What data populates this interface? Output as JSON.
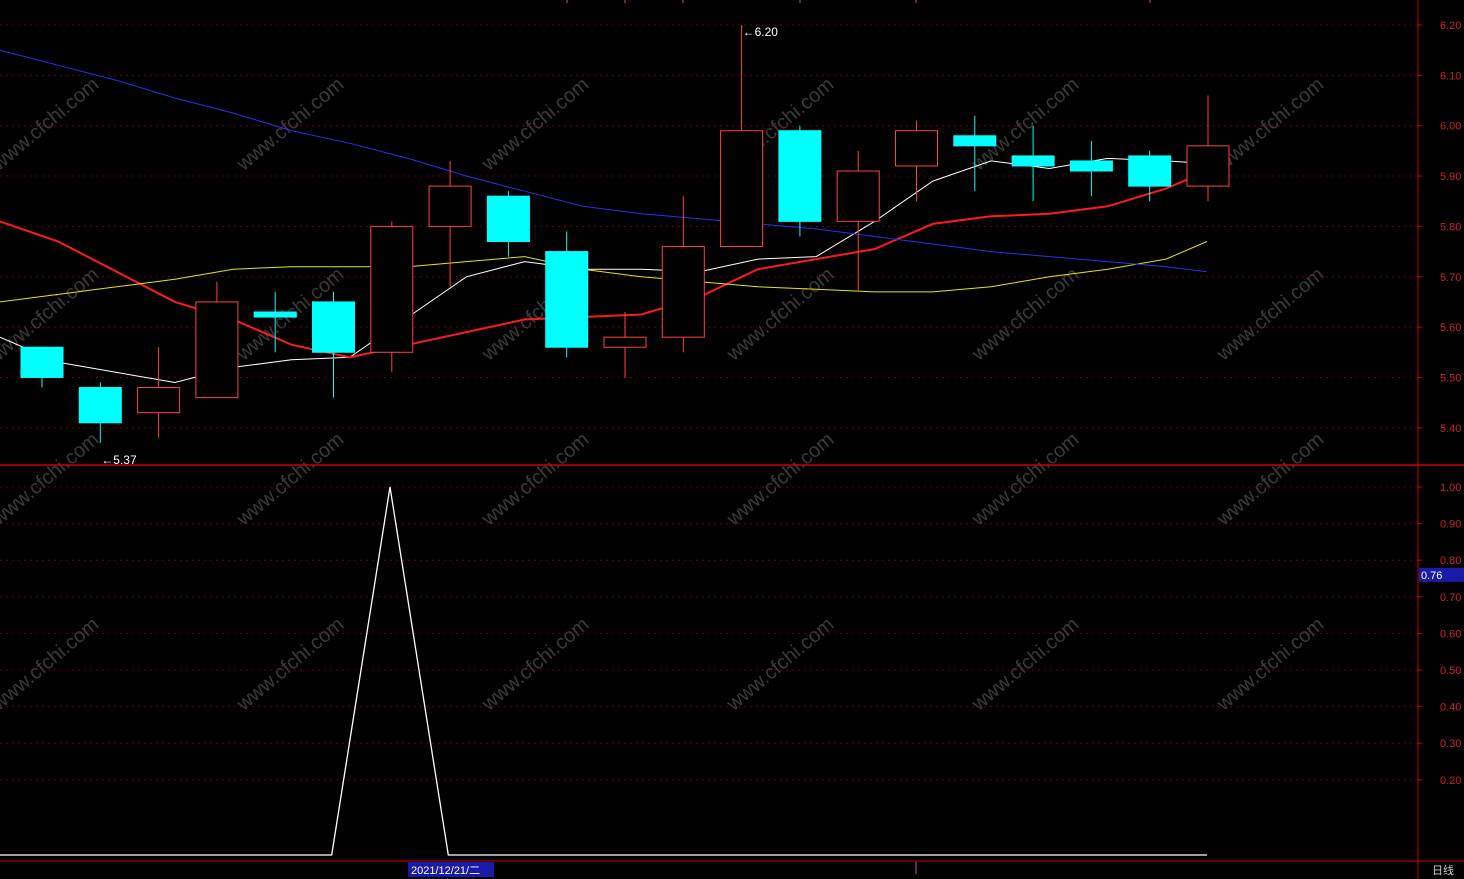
{
  "watermark": "www.cfchi.com",
  "period_label": "日线",
  "date_label": "2021/12/21/二",
  "colors": {
    "up": "#ff4040",
    "down": "#00ffff",
    "ma_white": "#ffffff",
    "ma_red": "#ff1a1a",
    "ma_yellow": "#e6e600",
    "ma_blue": "#2233ee",
    "axis": "#cc0000",
    "grid": "#6e0000",
    "highlight": "#1a1aa8"
  },
  "chart_data": [
    {
      "type": "candlestick",
      "name": "price",
      "y_ticks": [
        "6.20",
        "6.10",
        "6.00",
        "5.90",
        "5.80",
        "5.70",
        "5.60",
        "5.50",
        "5.40"
      ],
      "ylim": [
        5.325,
        6.235
      ],
      "grid": true,
      "annotations": [
        {
          "text": "6.20",
          "bar": 12,
          "value": 6.2
        },
        {
          "text": "5.37",
          "bar": 1,
          "value": 5.37
        }
      ],
      "candles": [
        {
          "open": 5.56,
          "high": 5.56,
          "low": 5.48,
          "close": 5.5
        },
        {
          "open": 5.48,
          "high": 5.49,
          "low": 5.37,
          "close": 5.41
        },
        {
          "open": 5.43,
          "high": 5.56,
          "low": 5.38,
          "close": 5.48
        },
        {
          "open": 5.46,
          "high": 5.69,
          "low": 5.46,
          "close": 5.65
        },
        {
          "open": 5.63,
          "high": 5.67,
          "low": 5.55,
          "close": 5.62
        },
        {
          "open": 5.65,
          "high": 5.67,
          "low": 5.46,
          "close": 5.55
        },
        {
          "open": 5.55,
          "high": 5.81,
          "low": 5.51,
          "close": 5.8
        },
        {
          "open": 5.8,
          "high": 5.93,
          "low": 5.68,
          "close": 5.88
        },
        {
          "open": 5.86,
          "high": 5.87,
          "low": 5.74,
          "close": 5.77
        },
        {
          "open": 5.75,
          "high": 5.79,
          "low": 5.54,
          "close": 5.56
        },
        {
          "open": 5.56,
          "high": 5.63,
          "low": 5.5,
          "close": 5.58
        },
        {
          "open": 5.58,
          "high": 5.86,
          "low": 5.55,
          "close": 5.76
        },
        {
          "open": 5.76,
          "high": 6.2,
          "low": 5.76,
          "close": 5.99
        },
        {
          "open": 5.99,
          "high": 6.0,
          "low": 5.78,
          "close": 5.81
        },
        {
          "open": 5.81,
          "high": 5.95,
          "low": 5.67,
          "close": 5.91
        },
        {
          "open": 5.92,
          "high": 6.01,
          "low": 5.85,
          "close": 5.99
        },
        {
          "open": 5.98,
          "high": 6.02,
          "low": 5.87,
          "close": 5.96
        },
        {
          "open": 5.94,
          "high": 6.0,
          "low": 5.85,
          "close": 5.92
        },
        {
          "open": 5.93,
          "high": 5.97,
          "low": 5.86,
          "close": 5.91
        },
        {
          "open": 5.94,
          "high": 5.95,
          "low": 5.85,
          "close": 5.88
        },
        {
          "open": 5.88,
          "high": 6.06,
          "low": 5.85,
          "close": 5.96
        }
      ],
      "series": [
        {
          "color": "white",
          "values": [
            5.58,
            5.53,
            5.51,
            5.49,
            5.52,
            5.535,
            5.54,
            5.62,
            5.7,
            5.73,
            5.715,
            5.715,
            5.71,
            5.735,
            5.74,
            5.81,
            5.89,
            5.93,
            5.915,
            5.935,
            5.93,
            5.925
          ]
        },
        {
          "color": "red",
          "values": [
            5.81,
            5.77,
            5.71,
            5.65,
            5.615,
            5.565,
            5.54,
            5.565,
            5.59,
            5.615,
            5.62,
            5.625,
            5.66,
            5.715,
            5.735,
            5.755,
            5.805,
            5.82,
            5.825,
            5.84,
            5.875,
            5.91
          ]
        },
        {
          "color": "yellow",
          "values": [
            5.65,
            5.665,
            5.68,
            5.695,
            5.715,
            5.72,
            5.72,
            5.72,
            5.73,
            5.74,
            5.715,
            5.7,
            5.69,
            5.68,
            5.675,
            5.67,
            5.67,
            5.68,
            5.7,
            5.715,
            5.735,
            5.77
          ]
        },
        {
          "color": "blue",
          "values": [
            6.15,
            6.12,
            6.09,
            6.055,
            6.025,
            5.99,
            5.965,
            5.935,
            5.9,
            5.87,
            5.84,
            5.825,
            5.815,
            5.805,
            5.795,
            5.78,
            5.765,
            5.75,
            5.74,
            5.73,
            5.72,
            5.71
          ]
        }
      ]
    },
    {
      "type": "line",
      "name": "indicator",
      "y_ticks": [
        "1.00",
        "0.90",
        "0.80",
        "0.70",
        "0.60",
        "0.50",
        "0.40",
        "0.30",
        "0.20"
      ],
      "ylim": [
        0.0,
        1.0
      ],
      "current_value": "0.76",
      "grid": true,
      "series": [
        {
          "color": "white",
          "values": [
            0,
            0,
            0,
            0,
            0,
            0,
            0,
            1,
            0,
            0,
            0,
            0,
            0,
            0,
            0,
            0,
            0,
            0,
            0,
            0,
            0
          ]
        }
      ]
    }
  ]
}
